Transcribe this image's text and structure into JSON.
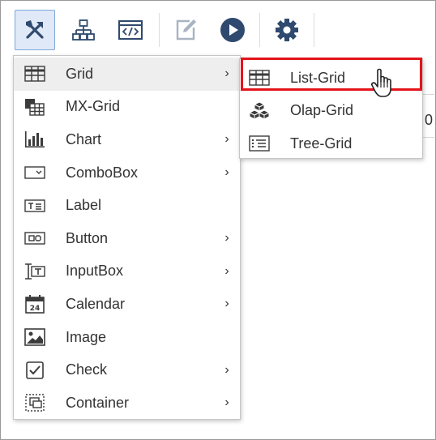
{
  "toolbar": {
    "buttons": [
      {
        "icon": "tools-icon",
        "active": true
      },
      {
        "icon": "sitemap-icon"
      },
      {
        "icon": "code-window-icon"
      },
      {
        "icon": "edit-icon"
      },
      {
        "icon": "play-icon"
      },
      {
        "icon": "gear-icon"
      }
    ]
  },
  "background": {
    "peek_text": "0"
  },
  "main_menu": {
    "items": [
      {
        "label": "Grid",
        "icon": "grid-icon",
        "has_submenu": true,
        "hovered": true
      },
      {
        "label": "MX-Grid",
        "icon": "mx-grid-icon",
        "has_submenu": false
      },
      {
        "label": "Chart",
        "icon": "bar-chart-icon",
        "has_submenu": true
      },
      {
        "label": "ComboBox",
        "icon": "combobox-icon",
        "has_submenu": true
      },
      {
        "label": "Label",
        "icon": "label-icon",
        "has_submenu": false
      },
      {
        "label": "Button",
        "icon": "button-icon",
        "has_submenu": true
      },
      {
        "label": "InputBox",
        "icon": "inputbox-icon",
        "has_submenu": true
      },
      {
        "label": "Calendar",
        "icon": "calendar-icon",
        "has_submenu": true
      },
      {
        "label": "Image",
        "icon": "image-icon",
        "has_submenu": false
      },
      {
        "label": "Check",
        "icon": "checkbox-icon",
        "has_submenu": true
      },
      {
        "label": "Container",
        "icon": "container-icon",
        "has_submenu": true
      }
    ]
  },
  "sub_menu": {
    "items": [
      {
        "label": "List-Grid",
        "icon": "list-grid-icon",
        "highlighted": true
      },
      {
        "label": "Olap-Grid",
        "icon": "olap-grid-icon"
      },
      {
        "label": "Tree-Grid",
        "icon": "tree-grid-icon"
      }
    ]
  },
  "colors": {
    "highlight_border": "#e4141b",
    "active_button": "#dfe9f7",
    "hover_row": "#eeeeee"
  }
}
